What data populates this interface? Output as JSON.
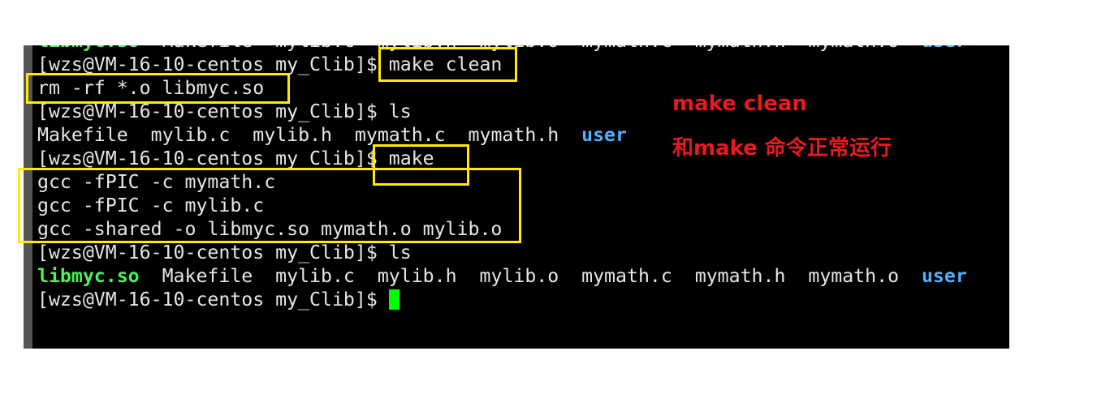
{
  "terminal": {
    "prompt": "[wzs@VM-16-10-centos my_Clib]$ ",
    "lines": [
      {
        "type": "ls-output",
        "items": [
          {
            "text": "libmyc.so",
            "color": "green"
          },
          {
            "text": "Makefile",
            "color": "default"
          },
          {
            "text": "mylib.c",
            "color": "default"
          },
          {
            "text": "mylib.h",
            "color": "default"
          },
          {
            "text": "mylib.o",
            "color": "default"
          },
          {
            "text": "mymath.c",
            "color": "default"
          },
          {
            "text": "mymath.h",
            "color": "default"
          },
          {
            "text": "mymath.o",
            "color": "default"
          },
          {
            "text": "user",
            "color": "blue"
          }
        ]
      },
      {
        "type": "command",
        "command": "make clean"
      },
      {
        "type": "output",
        "text": "rm -rf *.o libmyc.so"
      },
      {
        "type": "command",
        "command": "ls"
      },
      {
        "type": "ls-output",
        "items": [
          {
            "text": "Makefile",
            "color": "default"
          },
          {
            "text": "mylib.c",
            "color": "default"
          },
          {
            "text": "mylib.h",
            "color": "default"
          },
          {
            "text": "mymath.c",
            "color": "default"
          },
          {
            "text": "mymath.h",
            "color": "default"
          },
          {
            "text": "user",
            "color": "blue"
          }
        ]
      },
      {
        "type": "command",
        "command": "make"
      },
      {
        "type": "output",
        "text": "gcc -fPIC -c mymath.c"
      },
      {
        "type": "output",
        "text": "gcc -fPIC -c mylib.c"
      },
      {
        "type": "output",
        "text": "gcc -shared -o libmyc.so mymath.o mylib.o"
      },
      {
        "type": "command",
        "command": "ls"
      },
      {
        "type": "ls-output",
        "items": [
          {
            "text": "libmyc.so",
            "color": "green"
          },
          {
            "text": "Makefile",
            "color": "default"
          },
          {
            "text": "mylib.c",
            "color": "default"
          },
          {
            "text": "mylib.h",
            "color": "default"
          },
          {
            "text": "mylib.o",
            "color": "default"
          },
          {
            "text": "mymath.c",
            "color": "default"
          },
          {
            "text": "mymath.h",
            "color": "default"
          },
          {
            "text": "mymath.o",
            "color": "default"
          },
          {
            "text": "user",
            "color": "blue"
          }
        ]
      },
      {
        "type": "command",
        "command": ""
      }
    ],
    "colors": {
      "background": "#000000",
      "text": "#e6e6e6",
      "green": "#4ef05a",
      "blue": "#4fb2ff",
      "cursor": "#00ff00"
    }
  },
  "annotations": {
    "highlight_color": "#ffeb00",
    "text_color": "#e8191f",
    "note_line1": "make clean",
    "note_line2": "和make 命令正常运行"
  }
}
